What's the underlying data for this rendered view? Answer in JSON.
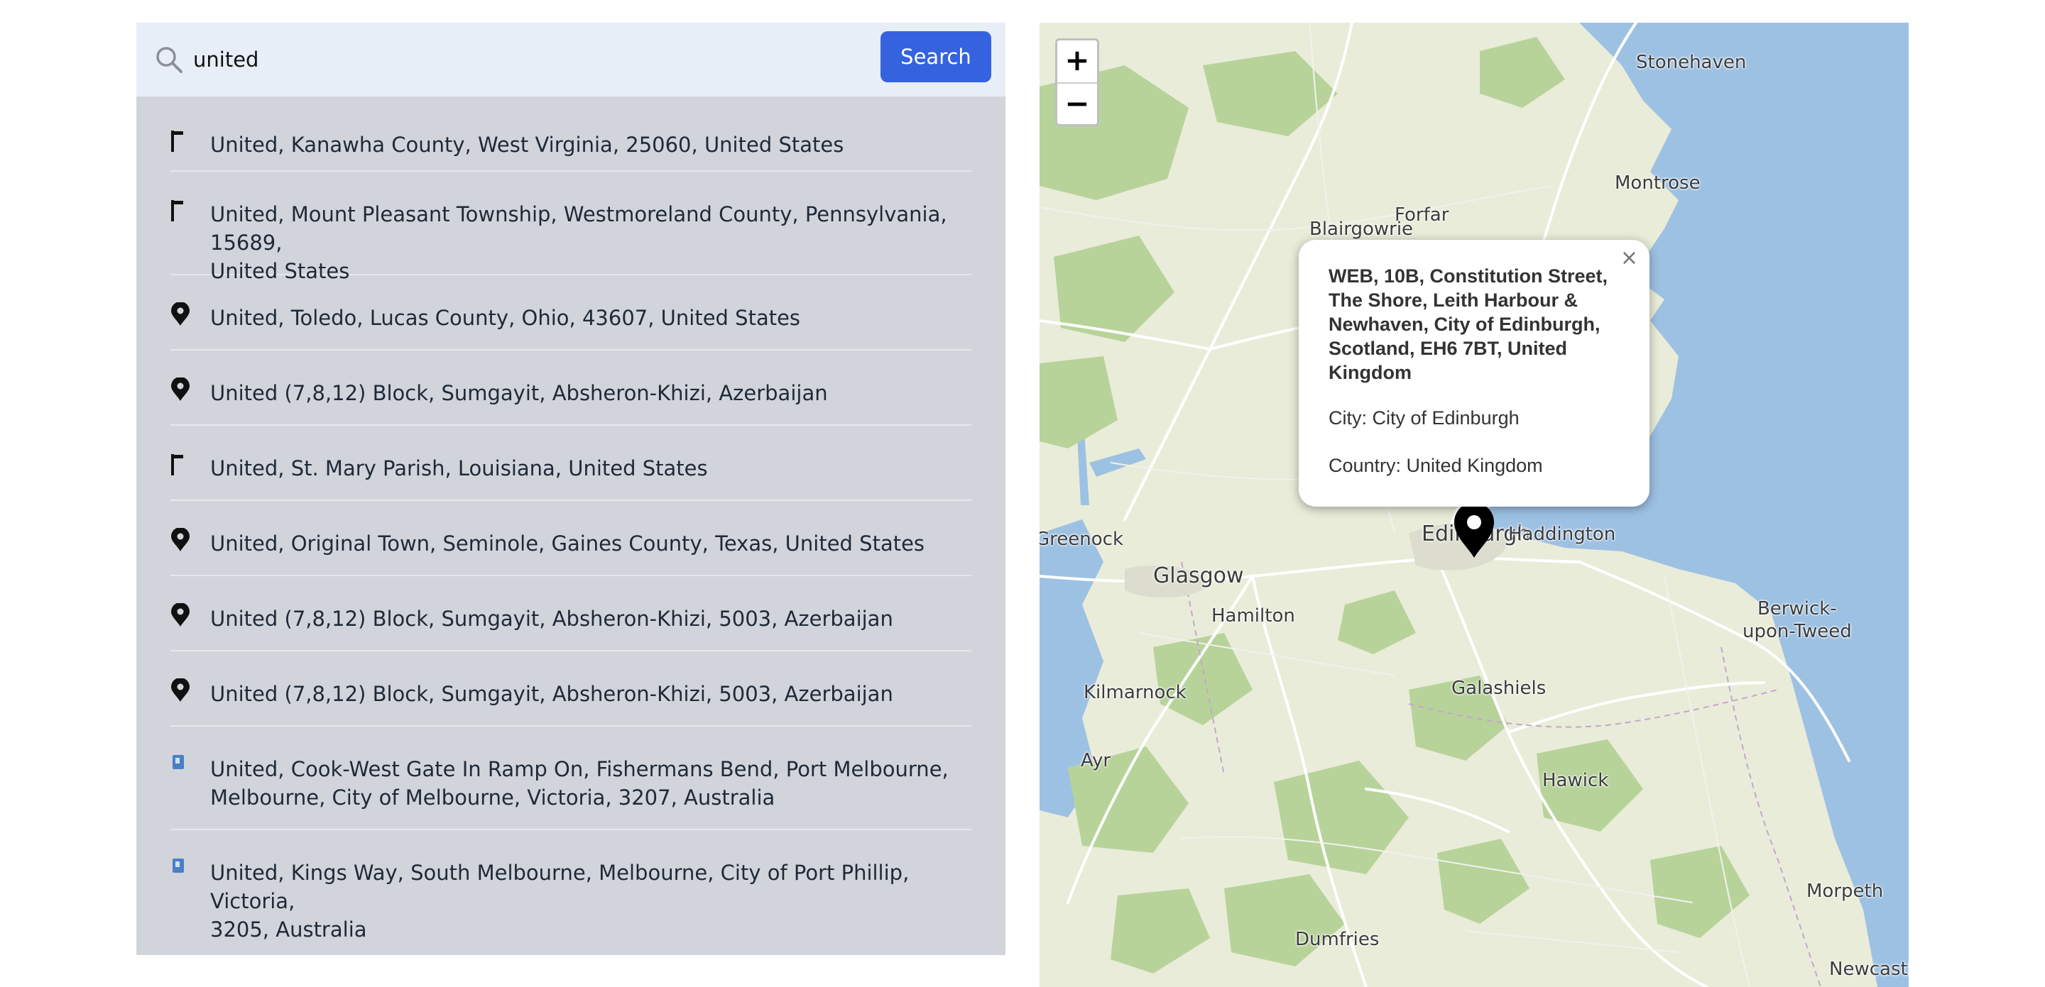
{
  "search": {
    "value": "united",
    "icon": "search-icon",
    "button_label": "Search"
  },
  "results": [
    {
      "text": "United, Kanawha County, West Virginia, 25060, United States",
      "icon": "flag-icon"
    },
    {
      "text": "United, Mount Pleasant Township, Westmoreland County, Pennsylvania, 15689,\nUnited States",
      "icon": "flag-icon"
    },
    {
      "text": "United, Toledo, Lucas County, Ohio, 43607, United States",
      "icon": "map-pin-icon"
    },
    {
      "text": "United (7,8,12) Block, Sumgayit, Absheron-Khizi, Azerbaijan",
      "icon": "map-pin-icon"
    },
    {
      "text": "United, St. Mary Parish, Louisiana, United States",
      "icon": "flag-icon"
    },
    {
      "text": "United, Original Town, Seminole, Gaines County, Texas, United States",
      "icon": "map-pin-icon"
    },
    {
      "text": "United (7,8,12) Block, Sumgayit, Absheron-Khizi, 5003, Azerbaijan",
      "icon": "map-pin-icon"
    },
    {
      "text": "United (7,8,12) Block, Sumgayit, Absheron-Khizi, 5003, Azerbaijan",
      "icon": "map-pin-icon"
    },
    {
      "text": "United, Cook-West Gate In Ramp On, Fishermans Bend, Port Melbourne,\nMelbourne, City of Melbourne, Victoria, 3207, Australia",
      "icon": "parking-icon"
    },
    {
      "text": "United, Kings Way, South Melbourne, Melbourne, City of Port Phillip, Victoria,\n3205, Australia",
      "icon": "parking-icon"
    }
  ],
  "map": {
    "zoom_in_label": "+",
    "zoom_out_label": "−",
    "place_labels": [
      "Stonehaven",
      "Montrose",
      "Forfar",
      "Blairgowrie",
      "Edinburgh",
      "Haddington",
      "Greenock",
      "Glasgow",
      "Hamilton",
      "Berwick-\nupon-Tweed",
      "Kilmarnock",
      "Galashiels",
      "Ayr",
      "Hawick",
      "Morpeth",
      "Dumfries",
      "Newcastl"
    ],
    "popup": {
      "close_label": "×",
      "title": "WEB, 10B, Constitution Street, The Shore, Leith Harbour & Newhaven, City of Edinburgh, Scotland, EH6 7BT, United Kingdom",
      "city_line": "City: City of Edinburgh",
      "country_line": "Country: United Kingdom"
    },
    "marker_icon": "map-marker-icon"
  },
  "colors": {
    "search_button": "#3563e0",
    "results_background": "#d1d5db",
    "search_bar_background": "#e8eef8",
    "map_land": "#e9ecd9",
    "map_water": "#9dc1e3",
    "map_forest": "#b7d39a"
  }
}
